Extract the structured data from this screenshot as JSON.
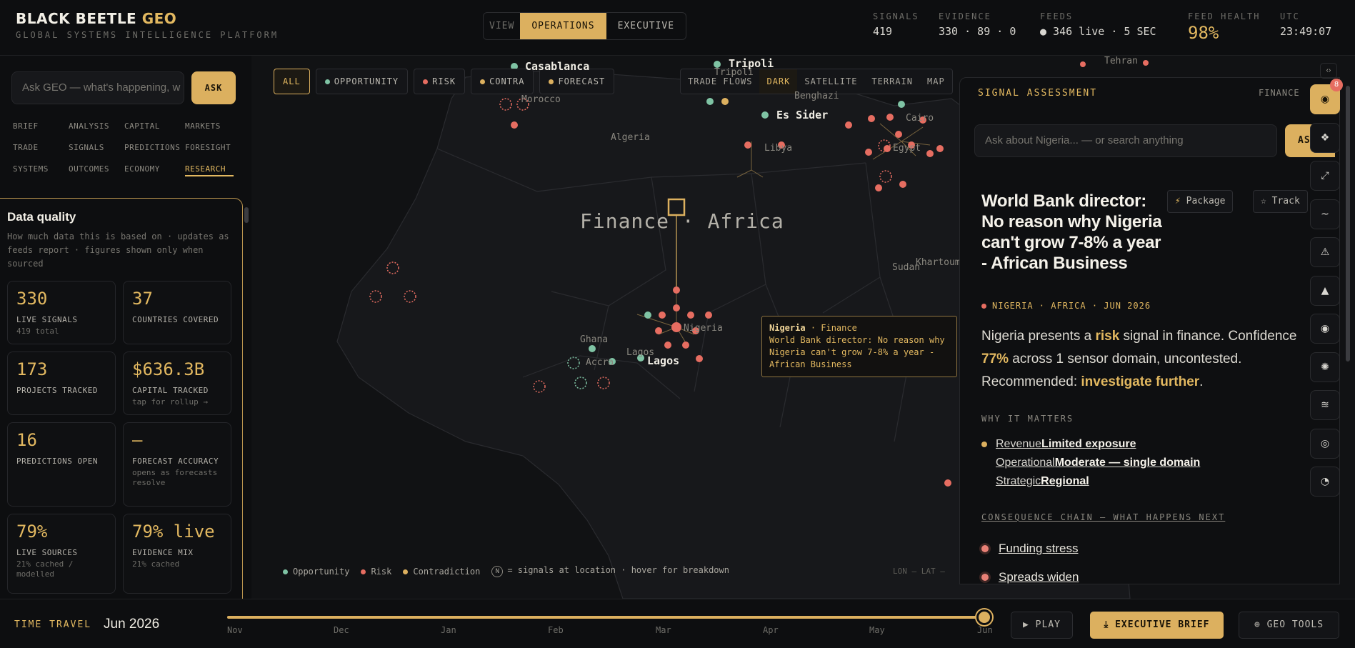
{
  "brand": {
    "name": "BLACK BEETLE",
    "accent": "GEO",
    "tagline": "GLOBAL SYSTEMS INTELLIGENCE PLATFORM"
  },
  "view_tabs": {
    "label": "VIEW",
    "items": [
      "OPERATIONS",
      "EXECUTIVE"
    ],
    "active": "OPERATIONS"
  },
  "stats": [
    {
      "key": "SIGNALS",
      "value": "419"
    },
    {
      "key": "EVIDENCE",
      "value": "330 · 89 · 0"
    },
    {
      "key": "FEEDS",
      "value": "● 346 live · 5 SEC"
    },
    {
      "key": "FEED HEALTH",
      "value": "98%"
    },
    {
      "key": "UTC",
      "value": "23:49:07"
    }
  ],
  "left": {
    "ask_placeholder": "Ask GEO — what's happening, w",
    "ask_button": "ASK",
    "nav": [
      "BRIEF",
      "ANALYSIS",
      "CAPITAL",
      "MARKETS",
      "TRADE",
      "SIGNALS",
      "PREDICTIONS",
      "FORESIGHT",
      "SYSTEMS",
      "OUTCOMES",
      "ECONOMY",
      "RESEARCH"
    ],
    "nav_active": "RESEARCH",
    "data_quality": {
      "title": "Data quality",
      "description": "How much data this is based on · updates as feeds report · figures shown only when sourced",
      "cards": [
        {
          "value": "330",
          "label": "LIVE SIGNALS",
          "sub": "419 total"
        },
        {
          "value": "37",
          "label": "COUNTRIES COVERED",
          "sub": ""
        },
        {
          "value": "173",
          "label": "PROJECTS TRACKED",
          "sub": ""
        },
        {
          "value": "$636.3B",
          "label": "CAPITAL TRACKED",
          "sub": "tap for rollup →"
        },
        {
          "value": "16",
          "label": "PREDICTIONS OPEN",
          "sub": ""
        },
        {
          "value": "—",
          "label": "FORECAST ACCURACY",
          "sub": "opens as forecasts resolve"
        },
        {
          "value": "79%",
          "label": "LIVE SOURCES",
          "sub": "21% cached / modelled"
        },
        {
          "value": "79% live",
          "label": "EVIDENCE MIX",
          "sub": "21% cached"
        }
      ]
    }
  },
  "map": {
    "filters": [
      {
        "label": "ALL",
        "color": ""
      },
      {
        "label": "OPPORTUNITY",
        "color": "#7fc3a4"
      },
      {
        "label": "RISK",
        "color": "#e66d61"
      },
      {
        "label": "CONTRA",
        "color": "#dcb05f"
      },
      {
        "label": "FORECAST",
        "color": "#dcb05f"
      }
    ],
    "layers": [
      "TRADE FLOWS",
      "DARK",
      "SATELLITE",
      "TERRAIN",
      "MAP"
    ],
    "layer_active": "DARK",
    "title": "Finance · Africa",
    "places": [
      "Casablanca",
      "Morocco",
      "Tripoli",
      "Tripoli",
      "Benghazi",
      "Es Sider",
      "Libya",
      "Algeria",
      "Cairo",
      "Egypt",
      "Tehran",
      "Sudan",
      "Khartoum",
      "Ghana",
      "Accra",
      "Lagos",
      "Lagos",
      "Nigeria"
    ],
    "tooltip": {
      "country": "Nigeria",
      "domain": "· Finance",
      "text": "World Bank director: No reason why Nigeria can't grow 7-8% a year - African Business"
    },
    "legend": [
      "Opportunity",
      "Risk",
      "Contradiction",
      "= signals at location · hover for breakdown"
    ],
    "legend_badge": "N",
    "coords": "LON — LAT —"
  },
  "assessment": {
    "header": "SIGNAL ASSESSMENT",
    "category": "FINANCE",
    "input_placeholder": "Ask about Nigeria... — or search anything",
    "ask_button": "ASK",
    "title": "World Bank director: No reason why Nigeria can't grow 7-8% a year - African Business",
    "package_button": "Package",
    "track_button": "Track",
    "meta": "NIGERIA · AFRICA · JUN 2026",
    "summary": {
      "p1": "Nigeria presents a ",
      "risk": "risk",
      "p2": " signal in finance. Confidence ",
      "conf": "77%",
      "p3": " across 1 sensor domain, uncontested. Recommended: ",
      "rec": "investigate further",
      "p4": "."
    },
    "why_header": "WHY IT MATTERS",
    "why": [
      {
        "k": "Revenue",
        "v": "Limited exposure"
      },
      {
        "k": "Operational",
        "v": "Moderate — single domain"
      },
      {
        "k": "Strategic",
        "v": "Regional"
      }
    ],
    "chain_header": "CONSEQUENCE CHAIN — WHAT HAPPENS NEXT",
    "chain": [
      "Funding stress",
      "Spreads widen"
    ]
  },
  "rail": {
    "badge": "8",
    "top": "‹›",
    "icons": [
      "target-icon",
      "network-icon",
      "expand-icon",
      "wave-icon",
      "alert-icon",
      "triangle-icon",
      "radar-icon",
      "sun-icon",
      "layers-icon",
      "ring-icon",
      "clock-icon"
    ]
  },
  "timeline": {
    "label": "TIME TRAVEL",
    "date": "Jun 2026",
    "months": [
      "Nov",
      "Dec",
      "Jan",
      "Feb",
      "Mar",
      "Apr",
      "May",
      "Jun"
    ],
    "play": "▶ PLAY",
    "brief": "⤓ EXECUTIVE BRIEF",
    "tools": "⊕ GEO TOOLS"
  },
  "colors": {
    "accent": "#dcb05f",
    "risk": "#e66d61",
    "opportunity": "#7fc3a4"
  }
}
